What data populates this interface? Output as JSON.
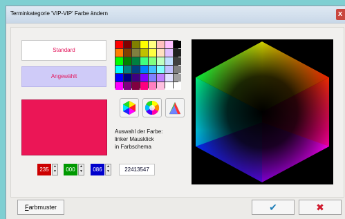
{
  "window": {
    "title": "Terminkategorie 'VIP-VIP' Farbe ändern",
    "close_glyph": "x"
  },
  "preview": {
    "standard_label": "Standard",
    "selected_label": "Angewählt",
    "current_color": "#EB1656"
  },
  "palette_colors": [
    "#ff0000",
    "#800000",
    "#808000",
    "#ffff00",
    "#ffff80",
    "#ffc0c0",
    "#ffc0ff",
    "#000000",
    "#ff8000",
    "#804000",
    "#808040",
    "#c0c000",
    "#ffff40",
    "#ffe0c0",
    "#e0c0ff",
    "#202020",
    "#00ff00",
    "#008000",
    "#008040",
    "#40ff80",
    "#80ff80",
    "#c0ffc0",
    "#c0e0ff",
    "#404040",
    "#00ffff",
    "#008080",
    "#004080",
    "#0080ff",
    "#40c0ff",
    "#80ffff",
    "#c0c0ff",
    "#808080",
    "#0000ff",
    "#000080",
    "#400080",
    "#8000ff",
    "#8080ff",
    "#c080ff",
    "#e0e0ff",
    "#a0a0a0",
    "#ff00ff",
    "#800080",
    "#800040",
    "#ff0080",
    "#ff80c0",
    "#ffc0e0",
    "#ffffff",
    "#ffffff"
  ],
  "scheme_buttons": [
    {
      "icon": "hexagon-scheme-icon"
    },
    {
      "icon": "color-wheel-icon"
    },
    {
      "icon": "triangle-scheme-icon"
    }
  ],
  "hint": {
    "line1": "Auswahl der Farbe:",
    "line2": "linker Mausklick",
    "line3": "in Farbschema"
  },
  "rgb": {
    "red": "235",
    "green": "000",
    "blue": "086",
    "red_color": "#cc0000",
    "green_color": "#009900",
    "blue_color": "#0000cc"
  },
  "color_code": "22413547",
  "footer": {
    "farbmuster_accel": "F",
    "farbmuster_rest": "arbmuster",
    "ok_glyph": "✔",
    "cancel_glyph": "✖",
    "ok_color": "#1f7fb8",
    "cancel_color": "#d0182c"
  }
}
